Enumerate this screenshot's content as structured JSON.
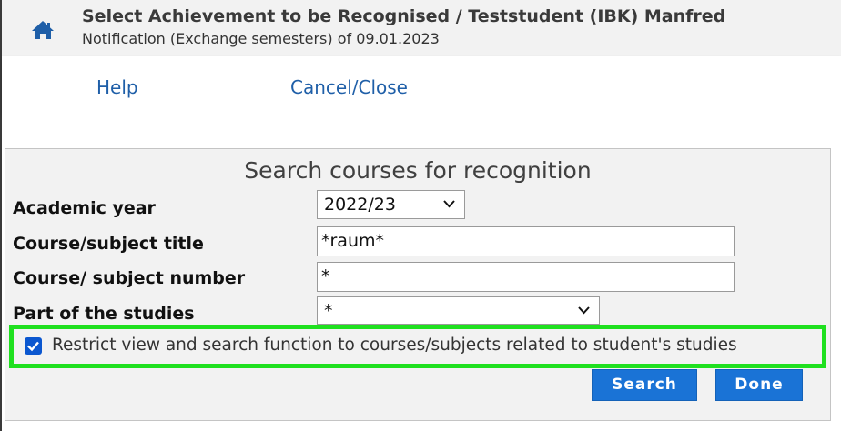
{
  "header": {
    "title": "Select Achievement to be Recognised  / Teststudent (IBK) Manfred",
    "subtitle": "Notification (Exchange semesters) of 09.01.2023",
    "home_icon": "home-icon"
  },
  "menu": {
    "help": "Help",
    "cancel_close": "Cancel/Close"
  },
  "search": {
    "panel_title": "Search courses for recognition",
    "fields": {
      "academic_year": {
        "label": "Academic year",
        "value": "2022/23"
      },
      "course_title": {
        "label": "Course/subject title",
        "value": "*raum*"
      },
      "course_number": {
        "label": "Course/ subject number",
        "value": "*"
      },
      "part_of_studies": {
        "label": "Part of the studies",
        "value": "*"
      }
    },
    "restrict": {
      "label": "Restrict view and search function to courses/subjects related to student's studies",
      "checked": true
    },
    "buttons": {
      "search": "Search",
      "done": "Done"
    }
  },
  "colors": {
    "accent": "#1a73d6",
    "link": "#1f5fa8",
    "highlight": "#1fe01f",
    "panel_bg": "#f2f2f2"
  }
}
